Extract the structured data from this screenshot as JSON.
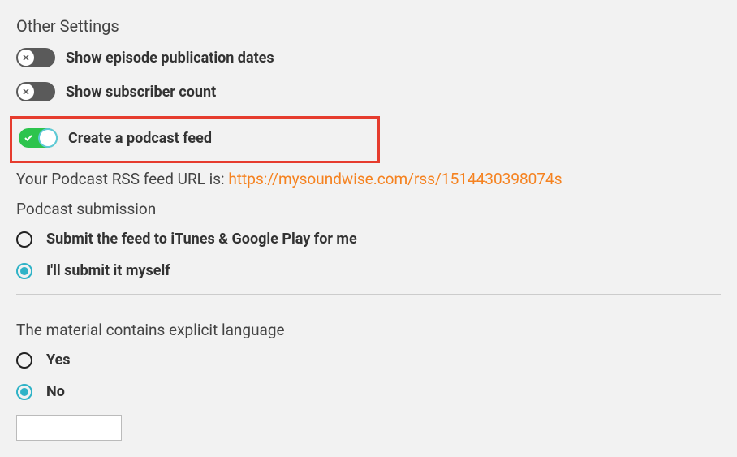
{
  "sectionHeading": "Other Settings",
  "toggles": {
    "showDates": {
      "label": "Show episode publication dates",
      "state": false
    },
    "showSubscribers": {
      "label": "Show subscriber count",
      "state": false
    },
    "createFeed": {
      "label": "Create a podcast feed",
      "state": true
    }
  },
  "rss": {
    "prefix": "Your Podcast RSS feed URL is: ",
    "url": "https://mysoundwise.com/rss/1514430398074s"
  },
  "submission": {
    "heading": "Podcast submission",
    "options": {
      "submitForMe": "Submit the feed to iTunes & Google Play for me",
      "submitMyself": "I'll submit it myself"
    },
    "selected": "submitMyself"
  },
  "explicit": {
    "heading": "The material contains explicit language",
    "options": {
      "yes": "Yes",
      "no": "No"
    },
    "selected": "no"
  }
}
